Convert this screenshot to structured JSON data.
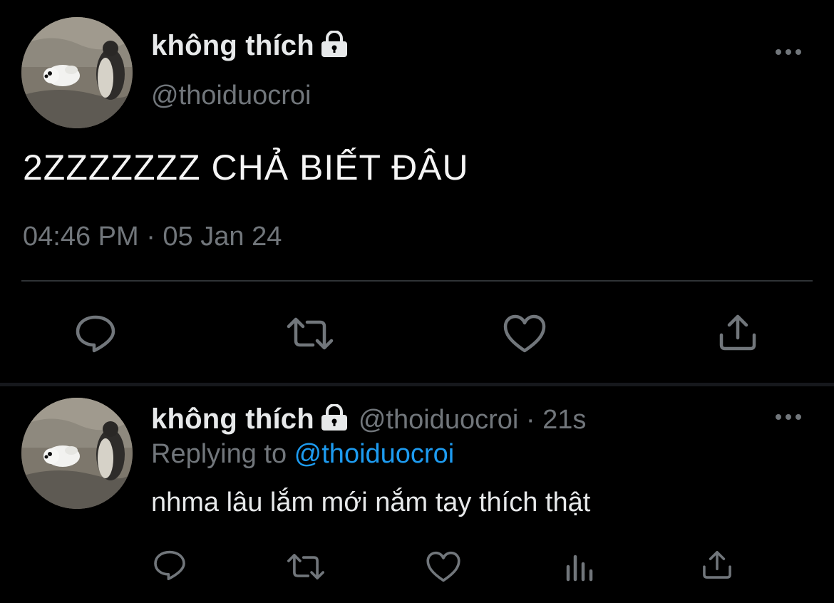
{
  "main_tweet": {
    "display_name": "không thích",
    "handle": "@thoiduocroi",
    "text": "2ZZZZZZZ CHẢ BIẾT ĐÂU",
    "timestamp": "04:46 PM · 05 Jan 24",
    "icons": [
      "lock-icon",
      "more-icon",
      "reply-icon",
      "retweet-icon",
      "like-icon",
      "share-icon"
    ]
  },
  "reply_tweet": {
    "display_name": "không thích",
    "handle": "@thoiduocroi",
    "separator": " · ",
    "age": "21s",
    "replying_prefix": "Replying to ",
    "replying_handle": "@thoiduocroi",
    "text": "nhma lâu lắm mới nắm tay thích thật",
    "icons": [
      "lock-icon",
      "more-icon",
      "reply-icon",
      "retweet-icon",
      "like-icon",
      "views-icon",
      "share-icon"
    ]
  },
  "colors": {
    "background": "#000000",
    "primary_text": "#e7e9ea",
    "secondary_text": "#71767b",
    "link": "#1d9bf0",
    "divider": "#2f3336"
  }
}
